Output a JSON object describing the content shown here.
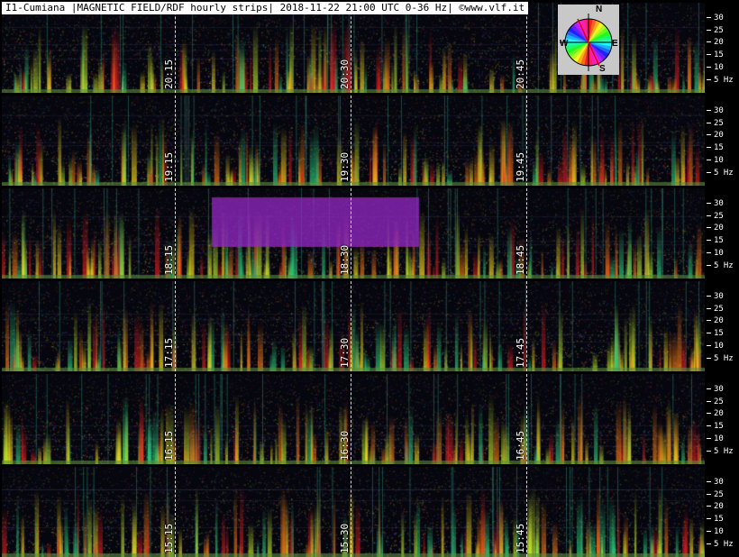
{
  "title": "I1-Cumiana |MAGNETIC FIELD/RDF hourly strips| 2018-11-22 21:00 UTC 0-36 Hz| ©www.vlf.it",
  "compass": {
    "n": "N",
    "e": "E",
    "s": "S",
    "w": "W"
  },
  "chart_data": {
    "type": "heatmap",
    "title": "I1-Cumiana |MAGNETIC FIELD/RDF hourly strips| 2018-11-22 21:00 UTC 0-36 Hz| ©www.vlf.it",
    "y_unit": "Hz",
    "y_range": [
      0,
      36
    ],
    "y_ticks": [
      "30",
      "25",
      "20",
      "15",
      "10",
      "5 Hz"
    ],
    "rows": [
      {
        "hour": "20",
        "labels": [
          "20:15",
          "20:30",
          "20:45"
        ]
      },
      {
        "hour": "19",
        "labels": [
          "19:15",
          "19:30",
          "19:45"
        ]
      },
      {
        "hour": "18",
        "labels": [
          "18:15",
          "18:30",
          "18:45"
        ]
      },
      {
        "hour": "17",
        "labels": [
          "17:15",
          "17:30",
          "17:45"
        ]
      },
      {
        "hour": "16",
        "labels": [
          "16:15",
          "16:30",
          "16:45"
        ]
      },
      {
        "hour": "15",
        "labels": [
          "15:15",
          "15:30",
          "15:45"
        ]
      }
    ]
  }
}
